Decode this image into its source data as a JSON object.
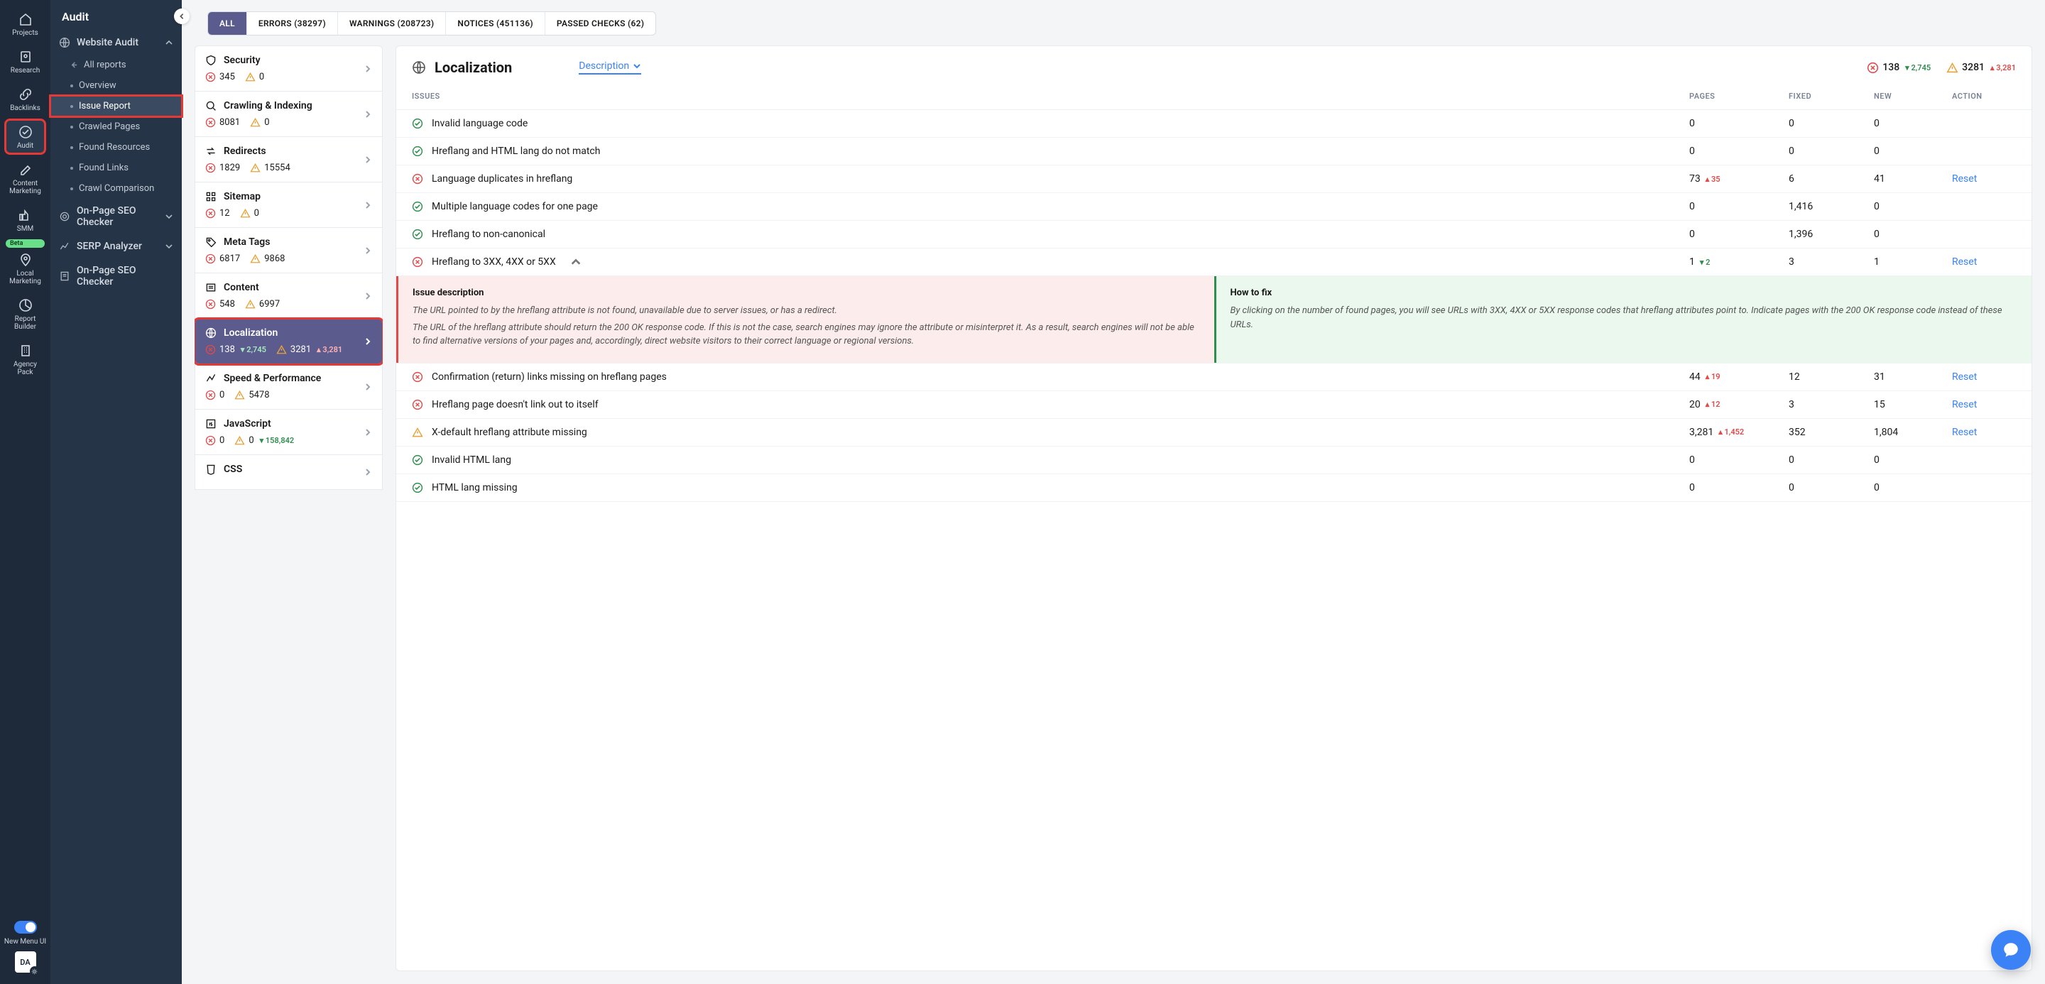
{
  "rail": {
    "items": [
      {
        "label": "Projects",
        "icon": "home"
      },
      {
        "label": "Research",
        "icon": "search-doc"
      },
      {
        "label": "Backlinks",
        "icon": "link"
      },
      {
        "label": "Audit",
        "icon": "check-circle",
        "active": true
      },
      {
        "label": "Content Marketing",
        "icon": "edit"
      },
      {
        "label": "SMM",
        "icon": "thumb"
      },
      {
        "label": "Local Marketing",
        "icon": "pin"
      },
      {
        "label": "Report Builder",
        "icon": "pie"
      },
      {
        "label": "Agency Pack",
        "icon": "building"
      }
    ],
    "beta_label": "Beta",
    "toggle_label": "New Menu UI",
    "user_initials": "DA"
  },
  "sidebar": {
    "title": "Audit",
    "section": "Website Audit",
    "items": [
      {
        "label": "All reports",
        "icon": "back"
      },
      {
        "label": "Overview",
        "icon": "dot"
      },
      {
        "label": "Issue Report",
        "icon": "dot",
        "active": true
      },
      {
        "label": "Crawled Pages",
        "icon": "dot"
      },
      {
        "label": "Found Resources",
        "icon": "dot"
      },
      {
        "label": "Found Links",
        "icon": "dot"
      },
      {
        "label": "Crawl Comparison",
        "icon": "dot"
      }
    ],
    "extra": [
      {
        "label": "On-Page SEO Checker",
        "icon": "target",
        "chev": true
      },
      {
        "label": "SERP Analyzer",
        "icon": "graph",
        "chev": true
      },
      {
        "label": "On-Page SEO Checker",
        "icon": "doc",
        "chev": false
      }
    ]
  },
  "pills": [
    {
      "label": "ALL",
      "active": true
    },
    {
      "label": "ERRORS (38297)"
    },
    {
      "label": "WARNINGS (208723)"
    },
    {
      "label": "NOTICES (451136)"
    },
    {
      "label": "PASSED CHECKS (62)"
    }
  ],
  "categories": [
    {
      "name": "Security",
      "icon": "shield",
      "err": "345",
      "warn": "0"
    },
    {
      "name": "Crawling & Indexing",
      "icon": "search",
      "err": "8081",
      "warn": "0"
    },
    {
      "name": "Redirects",
      "icon": "redirect",
      "err": "1829",
      "warn": "15554"
    },
    {
      "name": "Sitemap",
      "icon": "grid",
      "err": "12",
      "warn": "0"
    },
    {
      "name": "Meta Tags",
      "icon": "tag",
      "err": "6817",
      "warn": "9868"
    },
    {
      "name": "Content",
      "icon": "content",
      "err": "548",
      "warn": "6997"
    },
    {
      "name": "Localization",
      "icon": "globe",
      "err": "138",
      "err_delta": "2,745",
      "err_dir": "down",
      "warn": "3281",
      "warn_delta": "3,281",
      "warn_dir": "up",
      "active": true
    },
    {
      "name": "Speed & Performance",
      "icon": "speed",
      "err": "0",
      "warn": "5478"
    },
    {
      "name": "JavaScript",
      "icon": "js",
      "err": "0",
      "warn": "0",
      "warn_delta": "158,842",
      "warn_dir": "down"
    },
    {
      "name": "CSS",
      "icon": "css",
      "partial": true
    }
  ],
  "panel": {
    "title": "Localization",
    "dropdown": "Description",
    "err": "138",
    "err_delta": "2,745",
    "err_dir": "down",
    "warn": "3281",
    "warn_delta": "3,281",
    "warn_dir": "up",
    "headers": {
      "issues": "ISSUES",
      "pages": "PAGES",
      "fixed": "FIXED",
      "new": "NEW",
      "action": "ACTION"
    },
    "rows": [
      {
        "status": "ok",
        "name": "Invalid language code",
        "pages": "0",
        "fixed": "0",
        "new": "0"
      },
      {
        "status": "ok",
        "name": "Hreflang and HTML lang do not match",
        "pages": "0",
        "fixed": "0",
        "new": "0"
      },
      {
        "status": "err",
        "name": "Language duplicates in hreflang",
        "pages": "73",
        "pages_delta": "35",
        "pages_dir": "up",
        "fixed": "6",
        "new": "41",
        "action": "Reset"
      },
      {
        "status": "ok",
        "name": "Multiple language codes for one page",
        "pages": "0",
        "fixed": "1,416",
        "new": "0"
      },
      {
        "status": "ok",
        "name": "Hreflang to non-canonical",
        "pages": "0",
        "fixed": "1,396",
        "new": "0"
      },
      {
        "status": "err",
        "name": "Hreflang to 3XX, 4XX or 5XX",
        "pages": "1",
        "pages_delta": "2",
        "pages_dir": "down",
        "fixed": "3",
        "new": "1",
        "action": "Reset",
        "expanded": true
      },
      {
        "status": "err",
        "name": "Confirmation (return) links missing on hreflang pages",
        "pages": "44",
        "pages_delta": "19",
        "pages_dir": "up",
        "fixed": "12",
        "new": "31",
        "action": "Reset"
      },
      {
        "status": "err",
        "name": "Hreflang page doesn't link out to itself",
        "pages": "20",
        "pages_delta": "12",
        "pages_dir": "up",
        "fixed": "3",
        "new": "15",
        "action": "Reset"
      },
      {
        "status": "warn",
        "name": "X-default hreflang attribute missing",
        "pages": "3,281",
        "pages_delta": "1,452",
        "pages_dir": "up",
        "fixed": "352",
        "new": "1,804",
        "action": "Reset"
      },
      {
        "status": "ok",
        "name": "Invalid HTML lang",
        "pages": "0",
        "fixed": "0",
        "new": "0"
      },
      {
        "status": "ok",
        "name": "HTML lang missing",
        "pages": "0",
        "fixed": "0",
        "new": "0"
      }
    ],
    "expand": {
      "left_title": "Issue description",
      "left_p1": "The URL pointed to by the hreflang attribute is not found, unavailable due to server issues, or has a redirect.",
      "left_p2": "The URL of the hreflang attribute should return the 200 OK response code. If this is not the case, search engines may ignore the attribute or misinterpret it. As a result, search engines will not be able to find alternative versions of your pages and, accordingly, direct website visitors to their correct language or regional versions.",
      "right_title": "How to fix",
      "right_p1": "By clicking on the number of found pages, you will see URLs with 3XX, 4XX or 5XX response codes that hreflang attributes point to. Indicate pages with the 200 OK response code instead of these URLs."
    }
  }
}
